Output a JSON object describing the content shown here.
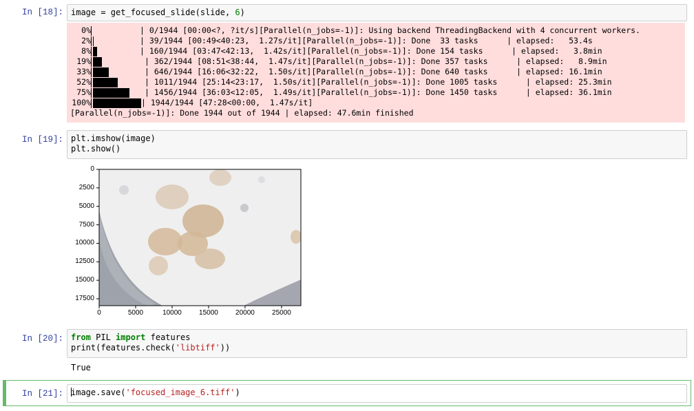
{
  "cells": {
    "c18": {
      "prompt": "In [18]:",
      "code_pre": "image = get_focused_slide(slide, ",
      "code_num": "6",
      "code_post": ")",
      "stderr": [
        {
          "pct": "0%",
          "text": "| 0/1944 [00:00<?, ?it/s][Parallel(n_jobs=-1)]: Using backend ThreadingBackend with 4 concurrent workers.",
          "progress": 0.0
        },
        {
          "pct": "2%",
          "text": "| 39/1944 [00:49<40:23,  1.27s/it][Parallel(n_jobs=-1)]: Done  33 tasks      | elapsed:   53.4s",
          "progress": 0.02
        },
        {
          "pct": "8%",
          "text": "| 160/1944 [03:47<42:13,  1.42s/it][Parallel(n_jobs=-1)]: Done 154 tasks      | elapsed:   3.8min",
          "progress": 0.08
        },
        {
          "pct": "19%",
          "text": "| 362/1944 [08:51<38:44,  1.47s/it][Parallel(n_jobs=-1)]: Done 357 tasks      | elapsed:   8.9min",
          "progress": 0.19
        },
        {
          "pct": "33%",
          "text": "| 646/1944 [16:06<32:22,  1.50s/it][Parallel(n_jobs=-1)]: Done 640 tasks      | elapsed: 16.1min",
          "progress": 0.33
        },
        {
          "pct": "52%",
          "text": "| 1011/1944 [25:14<23:17,  1.50s/it][Parallel(n_jobs=-1)]: Done 1005 tasks      | elapsed: 25.3min",
          "progress": 0.52
        },
        {
          "pct": "75%",
          "text": "| 1456/1944 [36:03<12:05,  1.49s/it][Parallel(n_jobs=-1)]: Done 1450 tasks      | elapsed: 36.1min",
          "progress": 0.75
        },
        {
          "pct": "100%",
          "text": "| 1944/1944 [47:28<00:00,  1.47s/it]",
          "progress": 1.0
        }
      ],
      "stderr_last": "[Parallel(n_jobs=-1)]: Done 1944 out of 1944 | elapsed: 47.6min finished"
    },
    "c19": {
      "prompt": "In [19]:",
      "line1": "plt.imshow(image)",
      "line2": "plt.show()"
    },
    "c20": {
      "prompt": "In [20]:",
      "kw_from": "from",
      "mod": " PIL ",
      "kw_import": "import",
      "rest1": " features",
      "line2_pre": "print(features.check(",
      "line2_str": "'libtiff'",
      "line2_post": "))",
      "output": "True"
    },
    "c21": {
      "prompt": "In [21]:",
      "code_pre": "image.save(",
      "code_str": "'focused_image_6.tiff'",
      "code_post": ")"
    }
  },
  "chart_data": {
    "type": "image",
    "x_ticks": [
      "0",
      "5000",
      "10000",
      "15000",
      "20000",
      "25000"
    ],
    "y_ticks": [
      "0",
      "2500",
      "5000",
      "7500",
      "10000",
      "12500",
      "15000",
      "17500"
    ],
    "xlim": [
      0,
      27648
    ],
    "ylim": [
      18432,
      0
    ],
    "title": "",
    "xlabel": "",
    "ylabel": ""
  },
  "colors": {
    "prompt": "#303f9f",
    "stderr_bg": "#ffdddd",
    "input_bg": "#f7f7f7",
    "selected": "#66bb6a",
    "keyword": "#008000",
    "string": "#ba2121"
  }
}
